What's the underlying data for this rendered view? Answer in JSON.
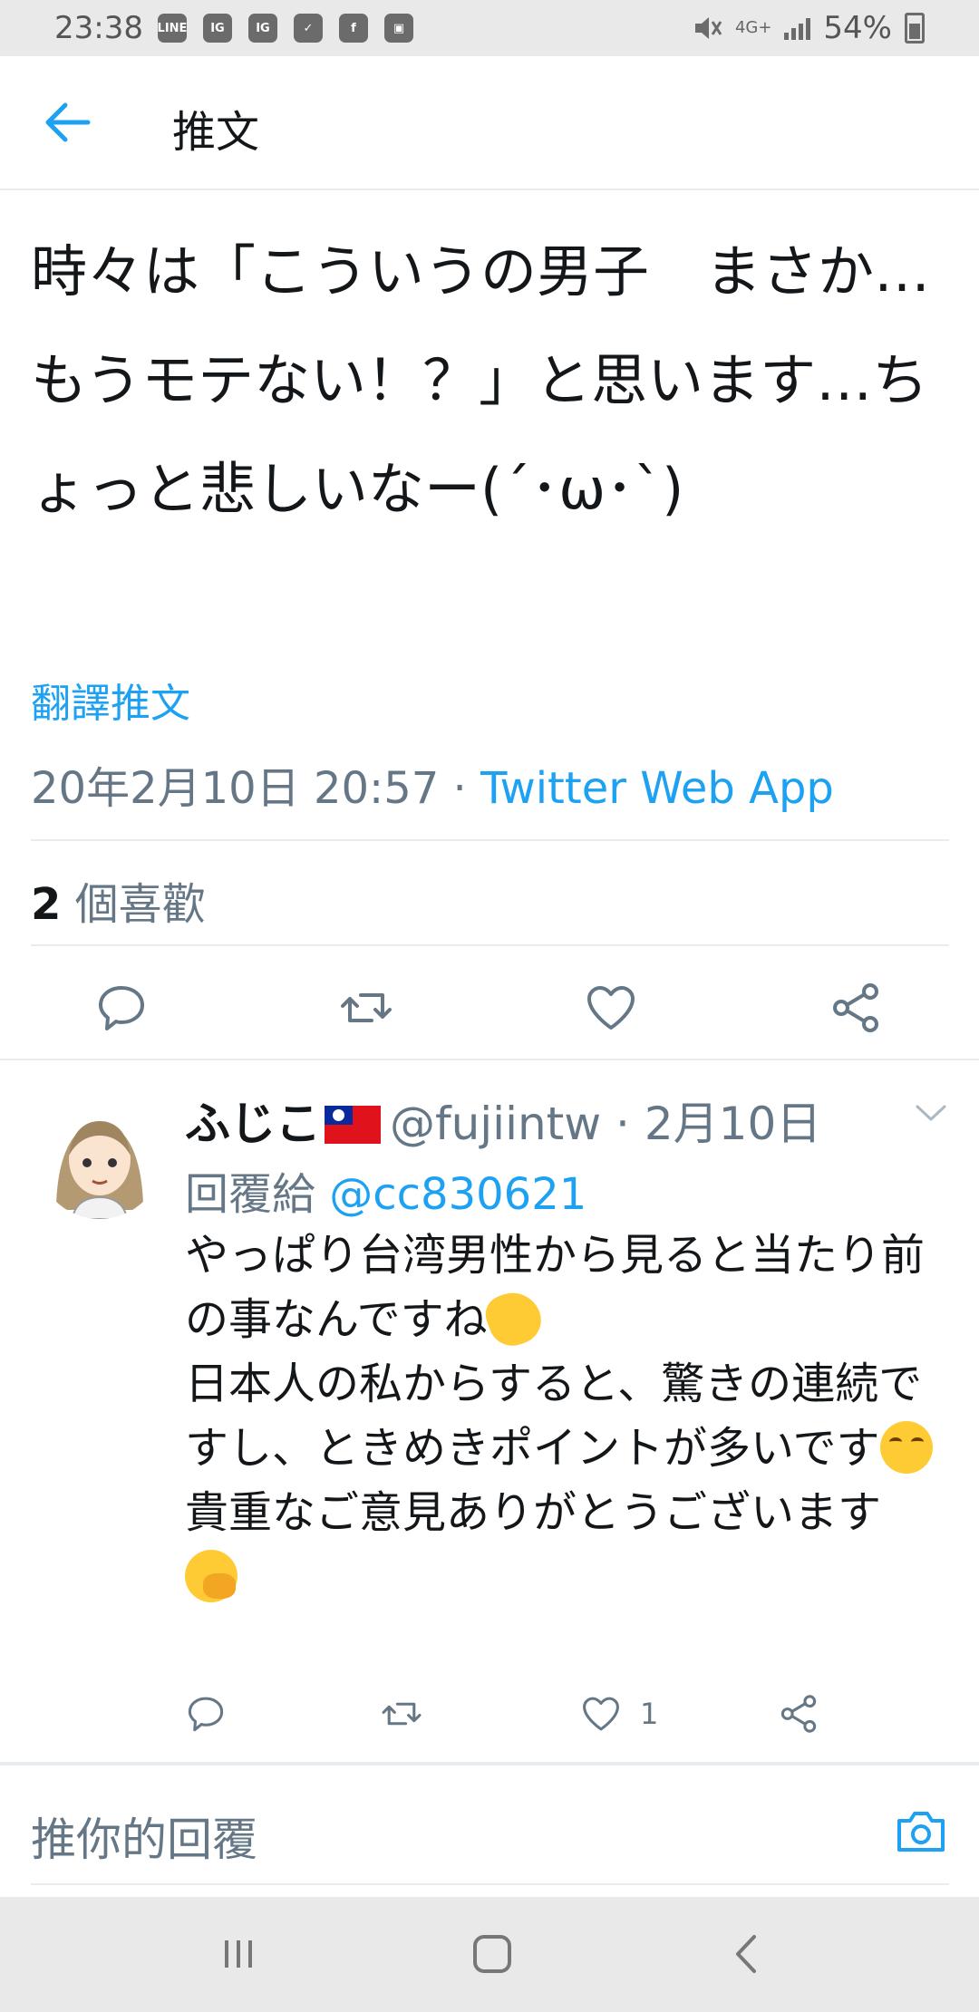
{
  "status_bar": {
    "time": "23:38",
    "app_icons": [
      "LINE",
      "IG",
      "IG",
      "✓",
      "f",
      "▣"
    ],
    "network": "4G+",
    "battery": "54%"
  },
  "header": {
    "title": "推文"
  },
  "tweet": {
    "text": "時々は「こういうの男子　まさか…もうモテない！？」と思います…ちょっと悲しいなー(´･ω･`)",
    "translate_label": "翻譯推文",
    "timestamp": "20年2月10日 20:57",
    "separator": " · ",
    "source_app": "Twitter Web App",
    "like_count": "2",
    "like_label": " 個喜歡"
  },
  "reply": {
    "name": "ふじこ",
    "handle": "@fujiintw",
    "date_sep": " · ",
    "date": "2月10日",
    "reply_to_label": "回覆給 ",
    "reply_to_handle": "@cc830621",
    "lines": [
      "やっぱり台湾男性から見ると当たり前の事なんですね",
      "日本人の私からすると、驚きの連続ですし、ときめきポイントが多いです",
      "貴重なご意見ありがとうございます"
    ],
    "like_count": "1"
  },
  "compose": {
    "placeholder": "推你的回覆"
  },
  "colors": {
    "accent": "#1da1f2",
    "secondary_text": "#657786",
    "divider": "#e6ecf0"
  }
}
